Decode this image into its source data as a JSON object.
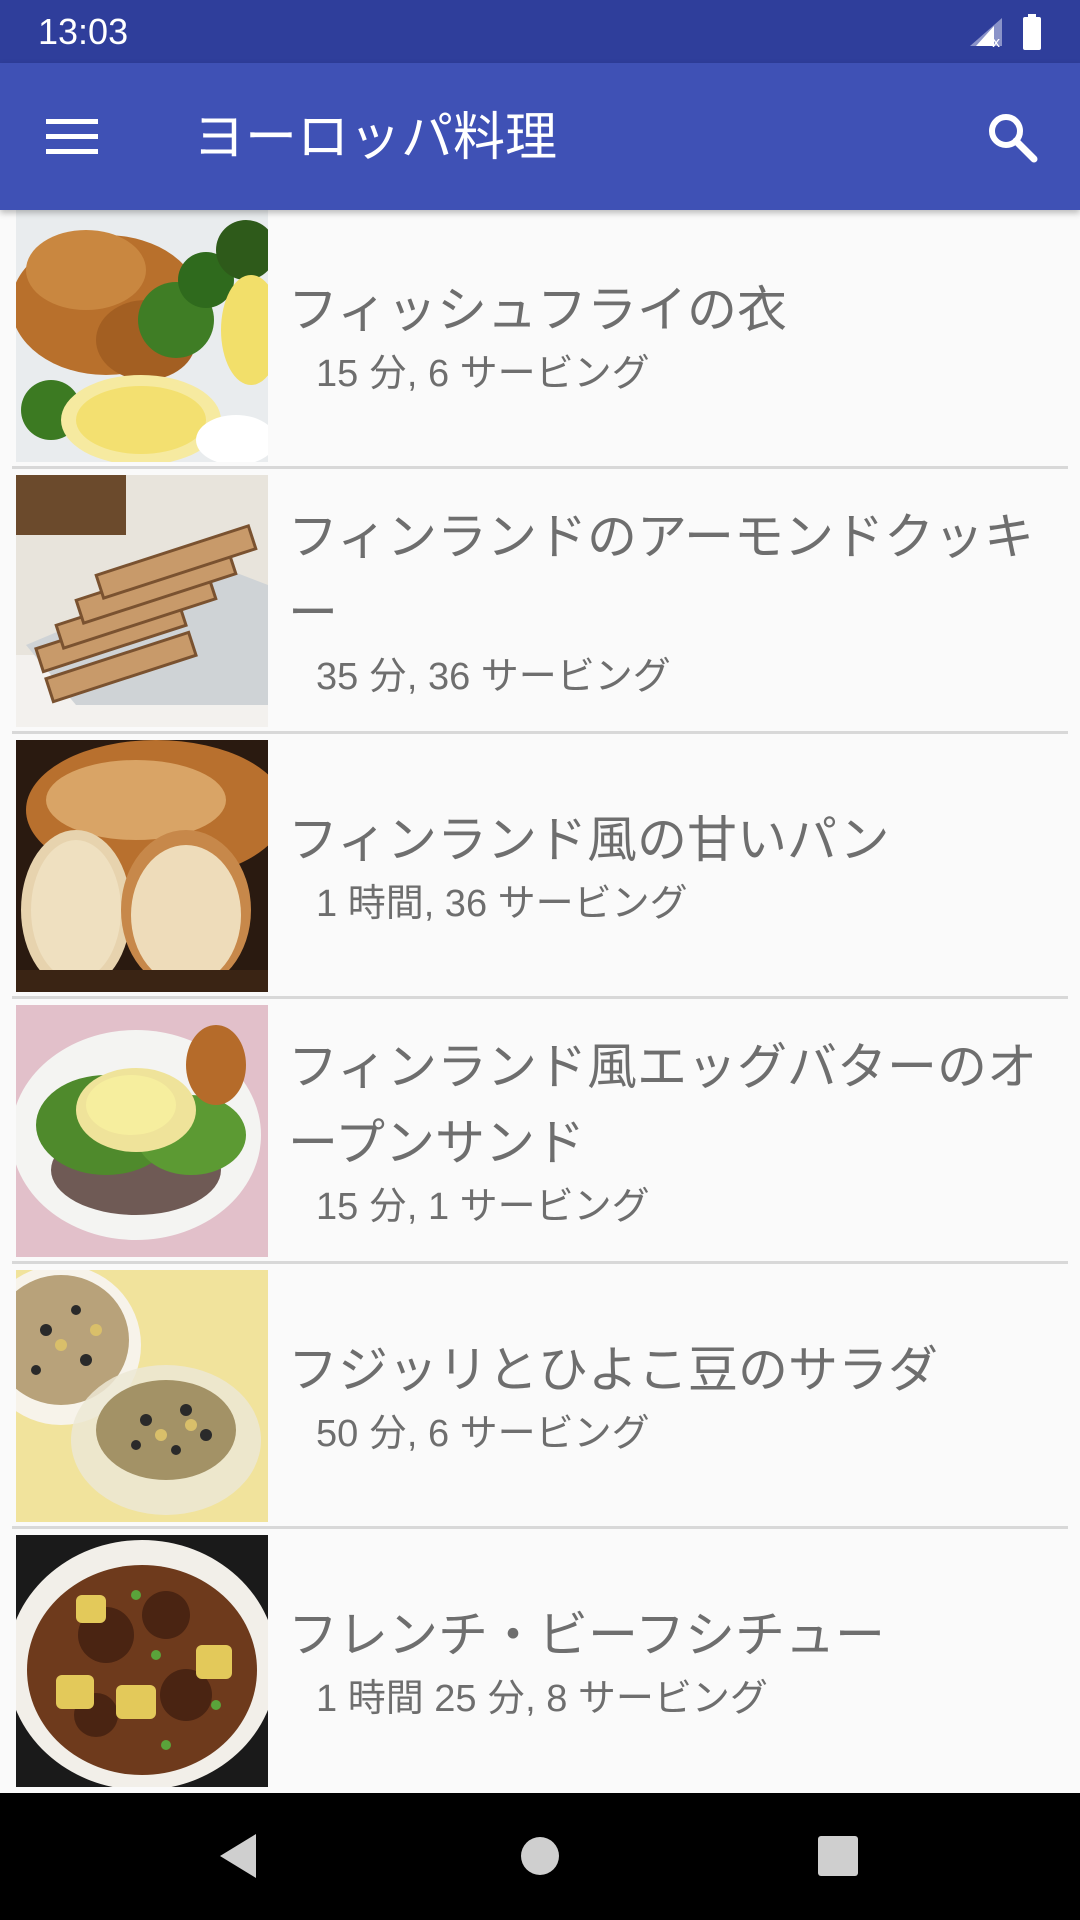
{
  "status_bar": {
    "time": "13:03",
    "icons": [
      "signal-icon",
      "battery-icon"
    ]
  },
  "app_bar": {
    "title": "ヨーロッパ料理",
    "menu_icon": "menu-icon",
    "search_icon": "search-icon"
  },
  "recipes": [
    {
      "title": "フィッシュフライの衣",
      "meta": "15 分, 6 サービング",
      "image": "fish-fry-photo"
    },
    {
      "title": "フィンランドのアーモンドクッキー",
      "meta": "35 分, 36 サービング",
      "image": "almond-cookie-photo"
    },
    {
      "title": "フィンランド風の甘いパン",
      "meta": "1 時間, 36 サービング",
      "image": "sweet-bread-photo"
    },
    {
      "title": "フィンランド風エッグバターのオープンサンド",
      "meta": "15 分, 1 サービング",
      "image": "egg-sandwich-photo"
    },
    {
      "title": "フジッリとひよこ豆のサラダ",
      "meta": "50 分, 6 サービング",
      "image": "chickpea-salad-photo"
    },
    {
      "title": "フレンチ・ビーフシチュー",
      "meta": "1 時間 25 分, 8 サービング",
      "image": "beef-stew-photo"
    }
  ],
  "colors": {
    "status_bar": "#2f3e9b",
    "app_bar": "#3f51b5",
    "text": "#6e6e6e",
    "background": "#fafafa"
  },
  "nav_bar": {
    "icons": [
      "back-icon",
      "home-icon",
      "recents-icon"
    ]
  }
}
